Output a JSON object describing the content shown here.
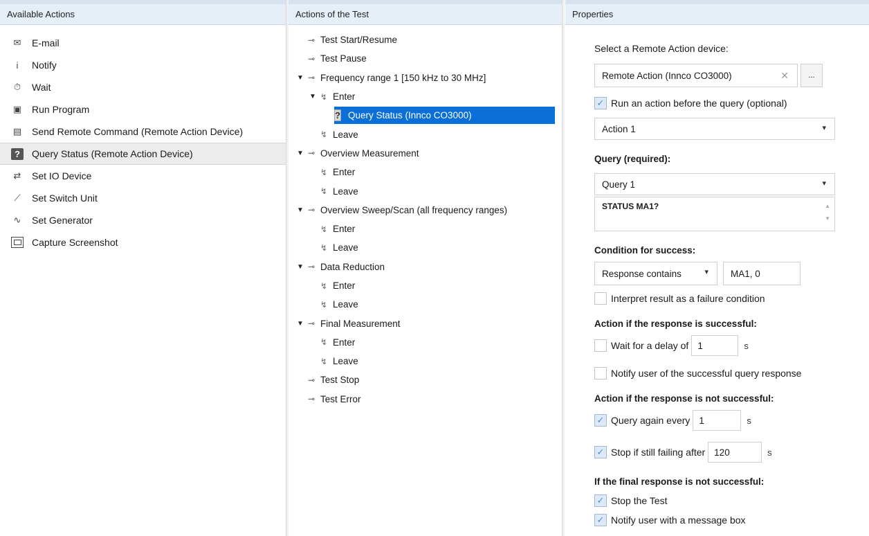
{
  "panels": {
    "available": "Available Actions",
    "test": "Actions of the Test",
    "properties": "Properties"
  },
  "available_actions": [
    {
      "label": "E-mail",
      "icon": "envelope-icon",
      "selected": false
    },
    {
      "label": "Notify",
      "icon": "info-icon",
      "selected": false
    },
    {
      "label": "Wait",
      "icon": "stopwatch-icon",
      "selected": false
    },
    {
      "label": "Run Program",
      "icon": "program-icon",
      "selected": false
    },
    {
      "label": "Send Remote Command (Remote Action Device)",
      "icon": "remote-command-icon",
      "selected": false
    },
    {
      "label": "Query Status (Remote Action Device)",
      "icon": "query-icon",
      "selected": true
    },
    {
      "label": "Set IO Device",
      "icon": "io-device-icon",
      "selected": false
    },
    {
      "label": "Set Switch Unit",
      "icon": "switch-icon",
      "selected": false
    },
    {
      "label": "Set Generator",
      "icon": "generator-icon",
      "selected": false
    },
    {
      "label": "Capture Screenshot",
      "icon": "camera-icon",
      "selected": false
    }
  ],
  "tree": [
    {
      "label": "Test Start/Resume",
      "level": 0,
      "expander": "",
      "icon": "event",
      "selected": false
    },
    {
      "label": "Test Pause",
      "level": 0,
      "expander": "",
      "icon": "event",
      "selected": false
    },
    {
      "label": "Frequency range 1 [150 kHz to 30 MHz]",
      "level": 0,
      "expander": "▼",
      "icon": "event",
      "selected": false
    },
    {
      "label": "Enter",
      "level": 1,
      "expander": "▼",
      "icon": "step",
      "selected": false
    },
    {
      "label": "Query Status (Innco CO3000)",
      "level": 2,
      "expander": "",
      "icon": "query",
      "selected": true
    },
    {
      "label": "Leave",
      "level": 1,
      "expander": "",
      "icon": "step",
      "selected": false
    },
    {
      "label": "Overview Measurement",
      "level": 0,
      "expander": "▼",
      "icon": "event",
      "selected": false
    },
    {
      "label": "Enter",
      "level": 1,
      "expander": "",
      "icon": "step",
      "selected": false
    },
    {
      "label": "Leave",
      "level": 1,
      "expander": "",
      "icon": "step",
      "selected": false
    },
    {
      "label": "Overview Sweep/Scan (all frequency ranges)",
      "level": 0,
      "expander": "▼",
      "icon": "event",
      "selected": false
    },
    {
      "label": "Enter",
      "level": 1,
      "expander": "",
      "icon": "step",
      "selected": false
    },
    {
      "label": "Leave",
      "level": 1,
      "expander": "",
      "icon": "step",
      "selected": false
    },
    {
      "label": "Data Reduction",
      "level": 0,
      "expander": "▼",
      "icon": "event",
      "selected": false
    },
    {
      "label": "Enter",
      "level": 1,
      "expander": "",
      "icon": "step",
      "selected": false
    },
    {
      "label": "Leave",
      "level": 1,
      "expander": "",
      "icon": "step",
      "selected": false
    },
    {
      "label": "Final Measurement",
      "level": 0,
      "expander": "▼",
      "icon": "event",
      "selected": false
    },
    {
      "label": "Enter",
      "level": 1,
      "expander": "",
      "icon": "step",
      "selected": false
    },
    {
      "label": "Leave",
      "level": 1,
      "expander": "",
      "icon": "step",
      "selected": false
    },
    {
      "label": "Test Stop",
      "level": 0,
      "expander": "",
      "icon": "event",
      "selected": false
    },
    {
      "label": "Test Error",
      "level": 0,
      "expander": "",
      "icon": "event",
      "selected": false
    }
  ],
  "props": {
    "select_device_label": "Select a Remote Action device:",
    "device_value": "Remote Action (Innco CO3000)",
    "browse_label": "...",
    "clear_glyph": "✕",
    "run_action_label": "Run an action before the query (optional)",
    "run_action_checked": true,
    "action_value": "Action 1",
    "query_label": "Query (required):",
    "query_value": "Query 1",
    "query_text": "STATUS MA1?",
    "condition_label": "Condition for success:",
    "condition_mode": "Response contains",
    "condition_value": "MA1, 0",
    "interpret_label": "Interpret result as a failure condition",
    "interpret_checked": false,
    "success_heading": "Action if the response is successful:",
    "wait_label": "Wait for a delay of",
    "wait_value": "1",
    "wait_unit": "s",
    "wait_checked": false,
    "notify_success_label": "Notify user of the successful query response",
    "notify_success_checked": false,
    "fail_heading": "Action if the response is not successful:",
    "query_again_label": "Query again every",
    "query_again_value": "1",
    "query_again_unit": "s",
    "query_again_checked": true,
    "stop_failing_label": "Stop if still failing after",
    "stop_failing_value": "120",
    "stop_failing_unit": "s",
    "stop_failing_checked": true,
    "final_heading": "If the final response is not successful:",
    "stop_test_label": "Stop the Test",
    "stop_test_checked": true,
    "notify_box_label": "Notify user with a message box",
    "notify_box_checked": true
  }
}
